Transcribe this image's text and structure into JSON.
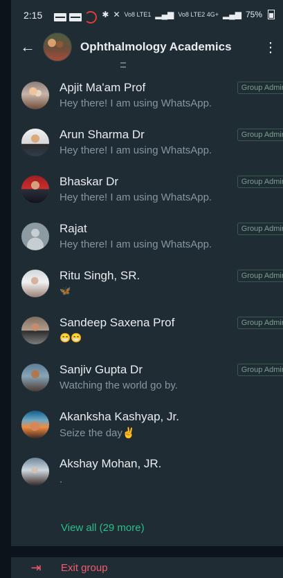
{
  "status_bar": {
    "time": "2:15",
    "battery_text": "75%",
    "network_left": "Vo8 LTE1",
    "network_right": "Vo8 LTE2 4G+"
  },
  "toolbar": {
    "back_icon": "arrow-left-icon",
    "title": "Ophthalmology Academics",
    "more_icon": "more-vertical-icon"
  },
  "members": [
    {
      "name": "Apjit Ma'am Prof",
      "status": "Hey there! I am using WhatsApp.",
      "badge": "Group Admin"
    },
    {
      "name": "Arun Sharma Dr",
      "status": "Hey there! I am using WhatsApp.",
      "badge": "Group Admin"
    },
    {
      "name": "Bhaskar Dr",
      "status": "Hey there! I am using WhatsApp.",
      "badge": "Group Admin"
    },
    {
      "name": "Rajat",
      "status": "Hey there! I am using WhatsApp.",
      "badge": "Group Admin"
    },
    {
      "name": "Ritu Singh, SR.",
      "status": "🦋",
      "badge": "Group Admin"
    },
    {
      "name": "Sandeep Saxena Prof",
      "status": "😁😁",
      "badge": "Group Admin"
    },
    {
      "name": "Sanjiv Gupta Dr",
      "status": "Watching the world go by.",
      "badge": "Group Admin"
    },
    {
      "name": "Akanksha Kashyap, Jr.",
      "status": "Seize the day✌️",
      "badge": ""
    },
    {
      "name": "Akshay Mohan, JR.",
      "status": ".",
      "badge": ""
    }
  ],
  "view_all": "View all (29 more)",
  "exit_group": "Exit group",
  "colors": {
    "background": "#1f2c34",
    "text": "#e9edef",
    "secondary_text": "#8696a0",
    "accent": "#2bbf8b",
    "danger": "#f15c6d"
  }
}
